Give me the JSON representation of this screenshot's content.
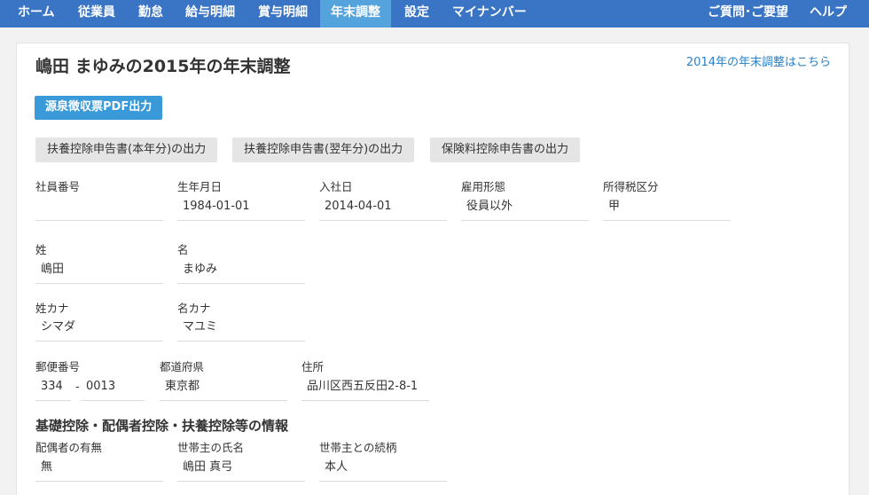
{
  "nav": {
    "items": [
      "ホーム",
      "従業員",
      "勤怠",
      "給与明細",
      "賞与明細",
      "年末調整",
      "設定",
      "マイナンバー"
    ],
    "right": [
      "ご質問･ご要望",
      "ヘルプ"
    ]
  },
  "page": {
    "title": "嶋田 まゆみの2015年の年末調整",
    "prev_link": "2014年の年末調整はこちら",
    "pdf_button": "源泉徴収票PDF出力",
    "buttons": [
      "扶養控除申告書(本年分)の出力",
      "扶養控除申告書(翌年分)の出力",
      "保険料控除申告書の出力"
    ]
  },
  "fields": {
    "employee_no": {
      "label": "社員番号",
      "value": ""
    },
    "birthdate": {
      "label": "生年月日",
      "value": "1984-01-01"
    },
    "join_date": {
      "label": "入社日",
      "value": "2014-04-01"
    },
    "employment_type": {
      "label": "雇用形態",
      "value": "役員以外"
    },
    "tax_category": {
      "label": "所得税区分",
      "value": "甲"
    },
    "last_name": {
      "label": "姓",
      "value": "嶋田"
    },
    "first_name": {
      "label": "名",
      "value": "まゆみ"
    },
    "last_name_kana": {
      "label": "姓カナ",
      "value": "シマダ"
    },
    "first_name_kana": {
      "label": "名カナ",
      "value": "マユミ"
    },
    "postal_code": {
      "label": "郵便番号",
      "value1": "334",
      "sep": "-",
      "value2": "0013"
    },
    "prefecture": {
      "label": "都道府県",
      "value": "東京都"
    },
    "address": {
      "label": "住所",
      "value": "品川区西五反田2-8-1"
    }
  },
  "deductions": {
    "heading": "基礎控除・配偶者控除・扶養控除等の情報",
    "spouse": {
      "label": "配偶者の有無",
      "value": "無"
    },
    "householder_name": {
      "label": "世帯主の氏名",
      "value": "嶋田 真弓"
    },
    "householder_relation": {
      "label": "世帯主との続柄",
      "value": "本人"
    }
  }
}
